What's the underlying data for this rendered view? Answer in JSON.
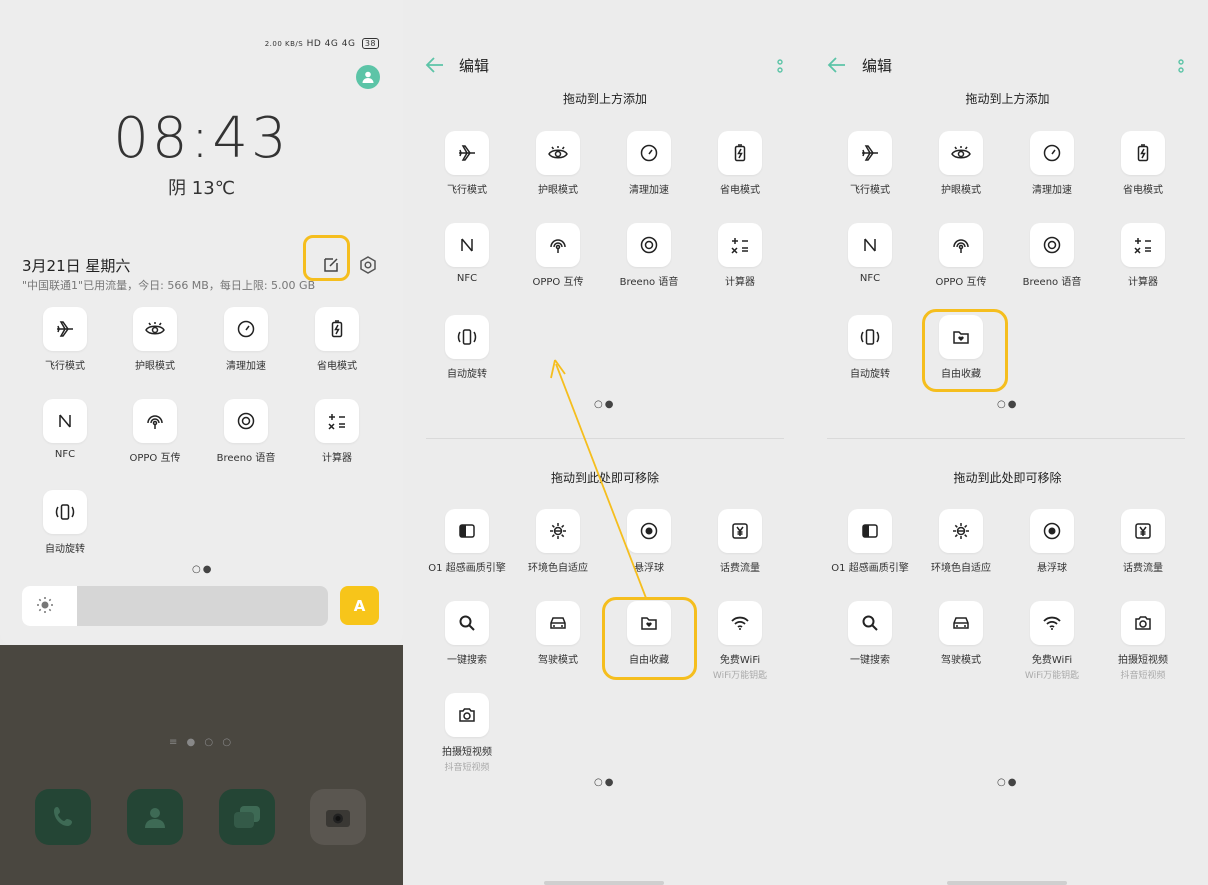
{
  "colors": {
    "accent": "#5cc4a7",
    "highlight": "#f5be1e",
    "auto_button": "#f7c51a"
  },
  "p1": {
    "status": {
      "speed": "2.00\nKB/S",
      "hd": "HD",
      "signal1": "4G",
      "signal2": "4G",
      "battery": "38"
    },
    "clock": "08:43",
    "weather": "阴 13℃",
    "date": "3月21日  星期六",
    "data_usage": "\"中国联通1\"已用流量，今日: 566 MB，每日上限: 5.00 GB",
    "tiles": [
      {
        "label": "飞行模式",
        "icon": "airplane-icon"
      },
      {
        "label": "护眼模式",
        "icon": "eye-icon"
      },
      {
        "label": "清理加速",
        "icon": "speedometer-icon"
      },
      {
        "label": "省电模式",
        "icon": "battery-saver-icon"
      },
      {
        "label": "NFC",
        "icon": "nfc-icon"
      },
      {
        "label": "OPPO 互传",
        "icon": "oppo-share-icon"
      },
      {
        "label": "Breeno 语音",
        "icon": "breeno-icon"
      },
      {
        "label": "计算器",
        "icon": "calculator-icon"
      },
      {
        "label": "自动旋转",
        "icon": "auto-rotate-icon"
      }
    ],
    "page_dots": "○●",
    "brightness_level": 0.18,
    "auto_label": "A",
    "home_dots": "≡ ● ○ ○"
  },
  "edit": {
    "title": "编辑",
    "add_header": "拖动到上方添加",
    "remove_header": "拖动到此处即可移除",
    "page_dots": "○●"
  },
  "p2": {
    "top_tiles": [
      {
        "label": "飞行模式",
        "icon": "airplane-icon"
      },
      {
        "label": "护眼模式",
        "icon": "eye-icon"
      },
      {
        "label": "清理加速",
        "icon": "speedometer-icon"
      },
      {
        "label": "省电模式",
        "icon": "battery-saver-icon"
      },
      {
        "label": "NFC",
        "icon": "nfc-icon"
      },
      {
        "label": "OPPO 互传",
        "icon": "oppo-share-icon"
      },
      {
        "label": "Breeno 语音",
        "icon": "breeno-icon"
      },
      {
        "label": "计算器",
        "icon": "calculator-icon"
      },
      {
        "label": "自动旋转",
        "icon": "auto-rotate-icon"
      }
    ],
    "bottom_tiles": [
      {
        "label": "O1 超感画质引擎",
        "icon": "display-engine-icon"
      },
      {
        "label": "环境色自适应",
        "icon": "ambient-color-icon"
      },
      {
        "label": "悬浮球",
        "icon": "floating-ball-icon"
      },
      {
        "label": "话费流量",
        "icon": "yen-icon"
      },
      {
        "label": "一键搜索",
        "icon": "search-icon"
      },
      {
        "label": "驾驶模式",
        "icon": "car-icon"
      },
      {
        "label": "自由收藏",
        "icon": "folder-heart-icon"
      },
      {
        "label": "免费WiFi",
        "sub": "WiFi万能钥匙",
        "icon": "wifi-icon"
      },
      {
        "label": "拍摄短视频",
        "sub": "抖音短视频",
        "icon": "camera-icon"
      }
    ]
  },
  "p3": {
    "top_tiles": [
      {
        "label": "飞行模式",
        "icon": "airplane-icon"
      },
      {
        "label": "护眼模式",
        "icon": "eye-icon"
      },
      {
        "label": "清理加速",
        "icon": "speedometer-icon"
      },
      {
        "label": "省电模式",
        "icon": "battery-saver-icon"
      },
      {
        "label": "NFC",
        "icon": "nfc-icon"
      },
      {
        "label": "OPPO 互传",
        "icon": "oppo-share-icon"
      },
      {
        "label": "Breeno 语音",
        "icon": "breeno-icon"
      },
      {
        "label": "计算器",
        "icon": "calculator-icon"
      },
      {
        "label": "自动旋转",
        "icon": "auto-rotate-icon"
      },
      {
        "label": "自由收藏",
        "icon": "folder-heart-icon"
      }
    ],
    "bottom_tiles": [
      {
        "label": "O1 超感画质引擎",
        "icon": "display-engine-icon"
      },
      {
        "label": "环境色自适应",
        "icon": "ambient-color-icon"
      },
      {
        "label": "悬浮球",
        "icon": "floating-ball-icon"
      },
      {
        "label": "话费流量",
        "icon": "yen-icon"
      },
      {
        "label": "一键搜索",
        "icon": "search-icon"
      },
      {
        "label": "驾驶模式",
        "icon": "car-icon"
      },
      {
        "label": "免费WiFi",
        "sub": "WiFi万能钥匙",
        "icon": "wifi-icon"
      },
      {
        "label": "拍摄短视频",
        "sub": "抖音短视频",
        "icon": "camera-icon"
      }
    ]
  }
}
